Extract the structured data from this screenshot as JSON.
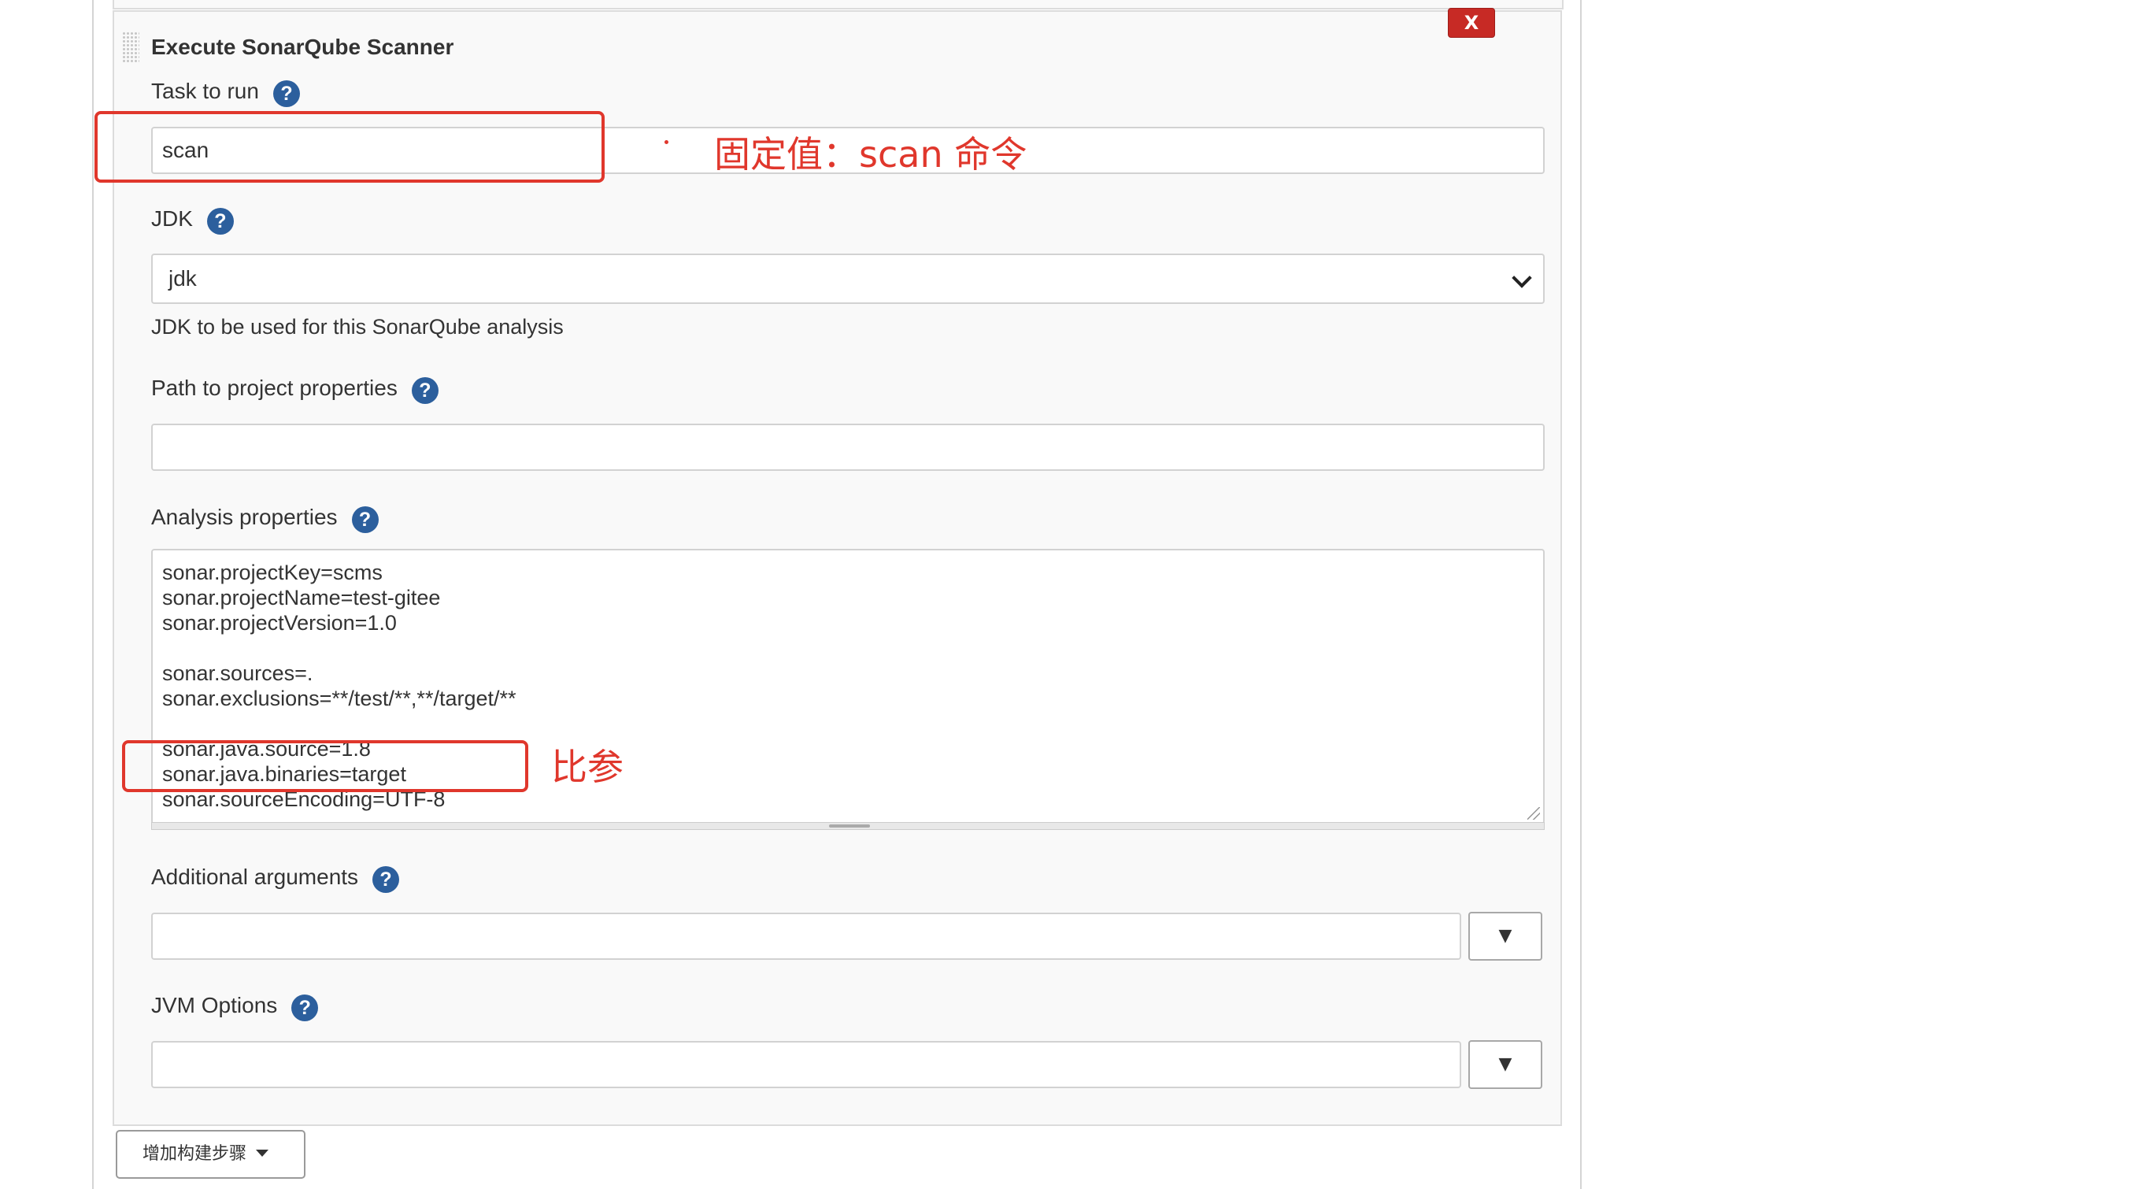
{
  "step": {
    "title": "Execute SonarQube Scanner",
    "delete_label": "X"
  },
  "task_to_run": {
    "label": "Task to run",
    "value": "scan"
  },
  "jdk": {
    "label": "JDK",
    "selected": "jdk",
    "hint": "JDK to be used for this SonarQube analysis"
  },
  "project_properties": {
    "label": "Path to project properties",
    "value": ""
  },
  "analysis_properties": {
    "label": "Analysis properties",
    "lines": [
      "sonar.projectKey=scms",
      "sonar.projectName=test-gitee",
      "sonar.projectVersion=1.0",
      "",
      "sonar.sources=.",
      "sonar.exclusions=**/test/**,**/target/**",
      "",
      "sonar.java.source=1.8",
      "sonar.java.binaries=target",
      "sonar.sourceEncoding=UTF-8"
    ]
  },
  "additional_arguments": {
    "label": "Additional arguments",
    "value": "",
    "dropdown_glyph": "▼"
  },
  "jvm_options": {
    "label": "JVM Options",
    "value": "",
    "dropdown_glyph": "▼"
  },
  "help_glyph": "?",
  "add_build_step": {
    "label": "增加构建步骤"
  },
  "annotations": {
    "fixed_value_note": "固定值：scan 命令",
    "compare_note": "比参"
  },
  "colors": {
    "annotation_red": "#e0372c",
    "help_blue": "#2c5f9d",
    "delete_red": "#c72a25"
  }
}
